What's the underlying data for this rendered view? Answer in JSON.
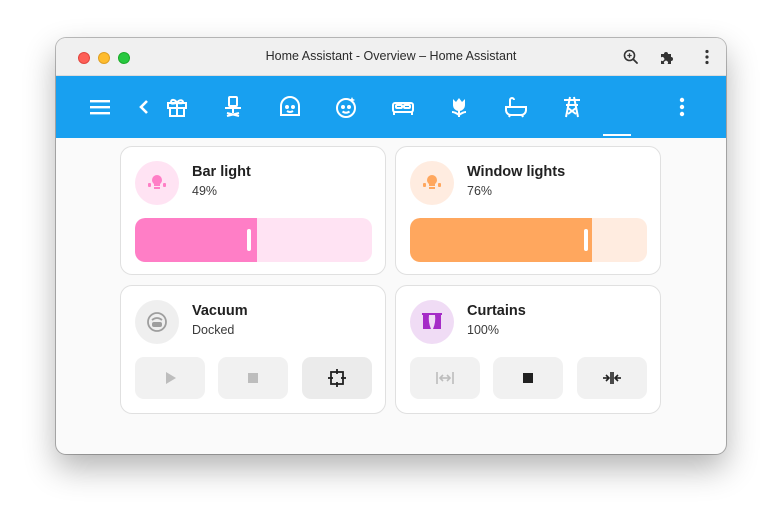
{
  "window": {
    "title": "Home Assistant - Overview – Home Assistant"
  },
  "toolbar_icons": [
    "zoom-icon",
    "extensions-icon",
    "more-vert-icon"
  ],
  "appbar": {
    "menu_icon": "menu-icon",
    "back_icon": "chevron-left-icon",
    "tabs": [
      {
        "icon": "gift-icon",
        "selected": false
      },
      {
        "icon": "desk-chair-icon",
        "selected": false
      },
      {
        "icon": "baby-face-icon",
        "selected": false
      },
      {
        "icon": "face-icon",
        "selected": false
      },
      {
        "icon": "bed-icon",
        "selected": false
      },
      {
        "icon": "flower-tulip-icon",
        "selected": false
      },
      {
        "icon": "bathtub-icon",
        "selected": false
      },
      {
        "icon": "transmission-tower-icon",
        "selected": false
      },
      {
        "icon": "current-tab",
        "selected": true
      }
    ],
    "more_icon": "more-vert-icon"
  },
  "cards": {
    "bar_light": {
      "name": "Bar light",
      "state": "49%",
      "level": 49,
      "color": "#ff7ec6",
      "track": "#ffe3f3"
    },
    "window_lights": {
      "name": "Window lights",
      "state": "76%",
      "level": 76,
      "color": "#ffa75e",
      "track": "#ffece0"
    },
    "vacuum": {
      "name": "Vacuum",
      "state": "Docked",
      "buttons": [
        "play-icon",
        "stop-icon",
        "target-icon"
      ]
    },
    "curtains": {
      "name": "Curtains",
      "state": "100%",
      "color": "#a52cc7",
      "buttons": [
        "open-icon",
        "stop-icon",
        "close-icon"
      ]
    }
  }
}
